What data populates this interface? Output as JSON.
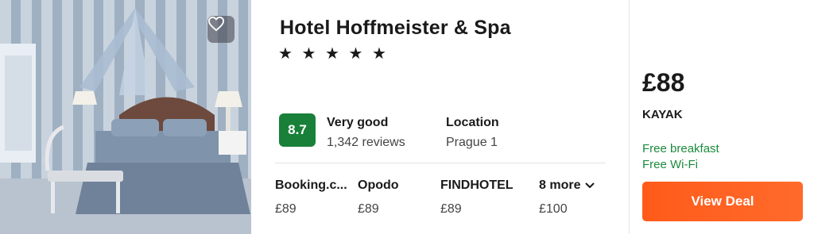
{
  "hotel": {
    "name": "Hotel Hoffmeister & Spa",
    "stars": "★ ★ ★ ★ ★",
    "star_count": 5,
    "score": "8.7",
    "rating_label": "Very good",
    "reviews": "1,342 reviews",
    "location_label": "Location",
    "location_value": "Prague 1"
  },
  "providers": [
    {
      "name": "Booking.c...",
      "price": "£89"
    },
    {
      "name": "Opodo",
      "price": "£89"
    },
    {
      "name": "FINDHOTEL",
      "price": "£89"
    }
  ],
  "more": {
    "label": "8 more",
    "price": "£100"
  },
  "deal": {
    "price": "£88",
    "source": "KAYAK",
    "amenities": [
      "Free breakfast",
      "Free Wi-Fi"
    ],
    "button_label": "View Deal"
  },
  "colors": {
    "score_bg": "#188038",
    "amenity_text": "#1b8a3c",
    "cta": "#ff5b1a"
  },
  "icons": {
    "favorite": "heart-icon",
    "more_toggle": "chevron-down-icon"
  }
}
